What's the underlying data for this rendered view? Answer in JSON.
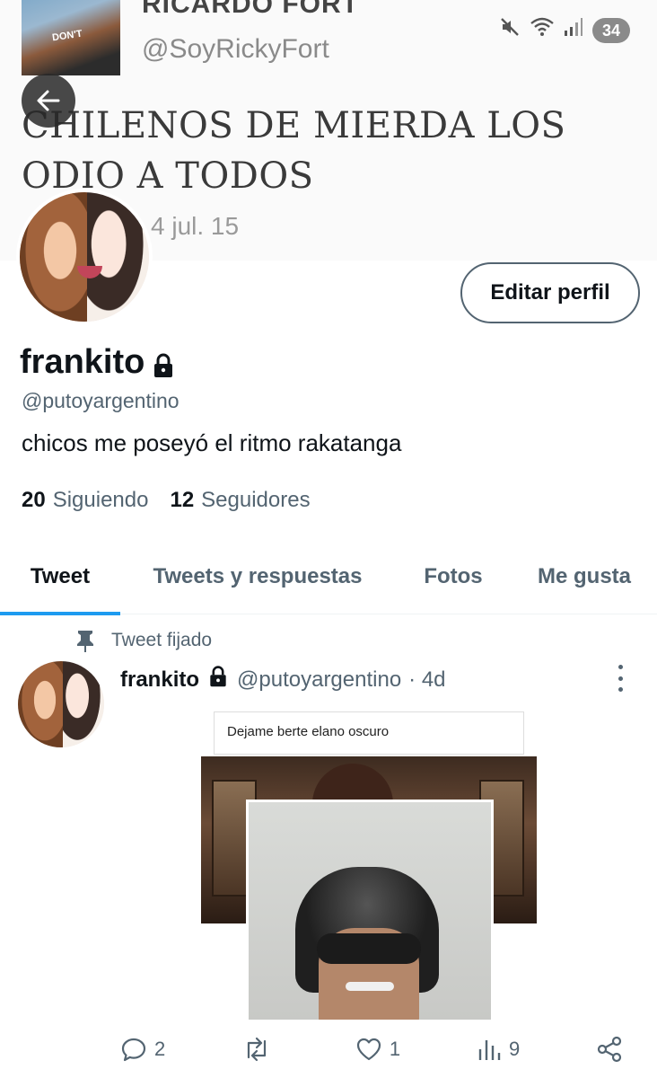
{
  "banner": {
    "tweet_author_name": "RICARDO FORT",
    "tweet_author_handle": "@SoyRickyFort",
    "tweet_text": "CHILENOS DE MIERDA LOS ODIO A TODOS",
    "tweet_date": "4 jul. 15",
    "shirt_text": "DON'T"
  },
  "status_bar": {
    "icons": [
      "mute-icon",
      "wifi-icon",
      "signal-icon"
    ],
    "battery": "34"
  },
  "profile": {
    "edit_button": "Editar perfil",
    "display_name": "frankito",
    "handle": "@putoyargentino",
    "bio": "chicos me poseyó el ritmo rakatanga",
    "following_count": "20",
    "following_label": "Siguiendo",
    "followers_count": "12",
    "followers_label": "Seguidores"
  },
  "tabs": [
    {
      "label": "Tweet",
      "active": true
    },
    {
      "label": "Tweets y respuestas",
      "active": false
    },
    {
      "label": "Fotos",
      "active": false
    },
    {
      "label": "Me gusta",
      "active": false
    }
  ],
  "tweet": {
    "pinned_label": "Tweet fijado",
    "author_name": "frankito",
    "author_handle": "@putoyargentino",
    "time": "· 4d",
    "media_caption": "Dejame berte elano oscuro",
    "replies": "2",
    "retweets": "",
    "likes": "1",
    "views": "9"
  },
  "colors": {
    "accent": "#1d9bf0",
    "text": "#0f1419",
    "secondary": "#536471"
  }
}
